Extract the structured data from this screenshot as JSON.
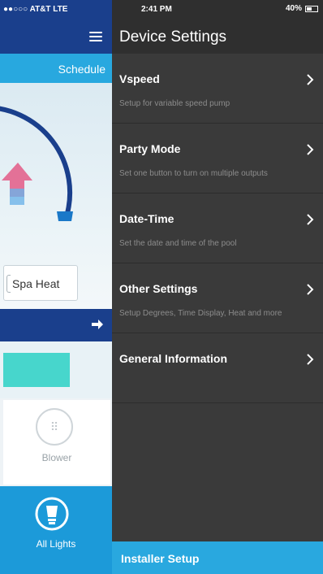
{
  "status_bar": {
    "carrier": "●●○○○ AT&T  LTE",
    "time": "2:41 PM",
    "battery": "40%"
  },
  "background_app": {
    "schedule_label": "Schedule",
    "spa_heat_label": "Spa Heat",
    "blower_label": "Blower",
    "lights_label": "All Lights"
  },
  "drawer": {
    "title": "Device Settings",
    "items": [
      {
        "title": "Vspeed",
        "subtitle": "Setup for variable speed pump"
      },
      {
        "title": "Party Mode",
        "subtitle": "Set one button to turn on multiple outputs"
      },
      {
        "title": "Date-Time",
        "subtitle": "Set the date and time of the pool"
      },
      {
        "title": "Other Settings",
        "subtitle": "Setup Degrees, Time Display, Heat and more"
      },
      {
        "title": "General Information",
        "subtitle": ""
      }
    ],
    "footer_label": "Installer Setup"
  },
  "icons": {
    "menu": "hamburger-icon",
    "chevron": "chevron-right-icon",
    "arrow": "arrow-right-icon",
    "blower": "blower-icon",
    "lights": "bulb-icon"
  },
  "colors": {
    "navy": "#1a3f8c",
    "accent_blue": "#29a8df",
    "drawer_bg": "#3a3a3a",
    "teal": "#47d6cc"
  }
}
